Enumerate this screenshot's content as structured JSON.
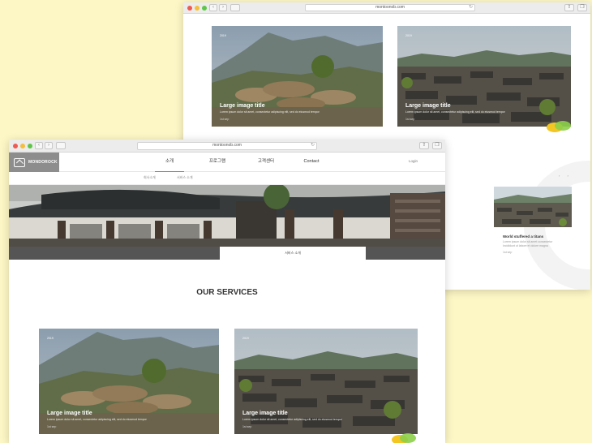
{
  "back_window": {
    "url": "montoonob.com",
    "cards": [
      {
        "tag": "2019",
        "title": "Large image title",
        "desc": "Lorem ipsum dolor sit amet, consectetur adipiscing elit, sed do eiusmod tempor",
        "meta": "1st sep"
      },
      {
        "tag": "2019",
        "title": "Large image title",
        "desc": "Lorem ipsum dolor sit amet, consectetur adipiscing elit, sed do eiusmod tempor",
        "meta": "1st sep"
      }
    ],
    "carousel": {
      "title": "World stuffered a titans",
      "sub1": "Lorem ipsum dolor sit amet consectetur",
      "sub2": "Incididunt ut labore et dolore magna",
      "meta": "1st sep",
      "cut_text": "Lorem ipsum",
      "cut_meta": "1st sep",
      "arrows": "‹ ›"
    }
  },
  "front_window": {
    "url": "montoonob.com",
    "logo_text": "MONDOROCK",
    "nav": [
      "소개",
      "프로그램",
      "고객센터",
      "Contact"
    ],
    "login": "Login",
    "subnav": [
      "회사소개",
      "서비스 소개"
    ],
    "tab_label": "서비스 소개",
    "services_title": "OUR SERVICES",
    "cards": [
      {
        "tag": "2019",
        "title": "Large image title",
        "desc": "Lorem ipsum dolor sit amet, consectetur adipiscing elit, sed do eiusmod tempor",
        "meta": "1st sep"
      },
      {
        "tag": "2019",
        "title": "Large image title",
        "desc": "Lorem ipsum dolor sit amet, consectetur adipiscing elit, sed do eiusmod tempor",
        "meta": "1st sep"
      }
    ]
  },
  "icons": {
    "back": "chevron-left-icon",
    "forward": "chevron-right-icon",
    "share": "share-icon",
    "tabs": "tabs-icon",
    "reload": "reload-icon"
  },
  "colors": {
    "page_bg": "#fdf7c6",
    "accent": "#4a8fd8",
    "blob_green": "#8ccf4a",
    "blob_yellow": "#f3c623"
  }
}
